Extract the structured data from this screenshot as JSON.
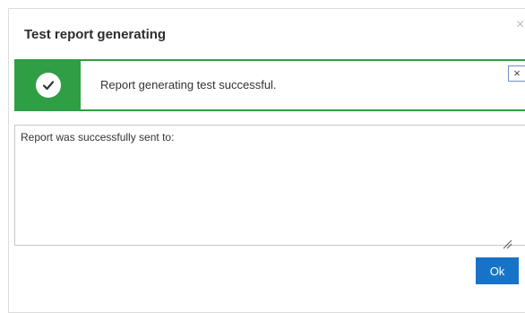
{
  "dialog": {
    "title": "Test report generating",
    "close_glyph": "×"
  },
  "alert": {
    "message": "Report generating test successful.",
    "icon": "check-circle-icon",
    "close_glyph": "×",
    "accent_color": "#2f9e44"
  },
  "message_box": {
    "value": "Report was successfully sent to:"
  },
  "actions": {
    "ok_label": "Ok",
    "ok_color": "#1773c7"
  }
}
